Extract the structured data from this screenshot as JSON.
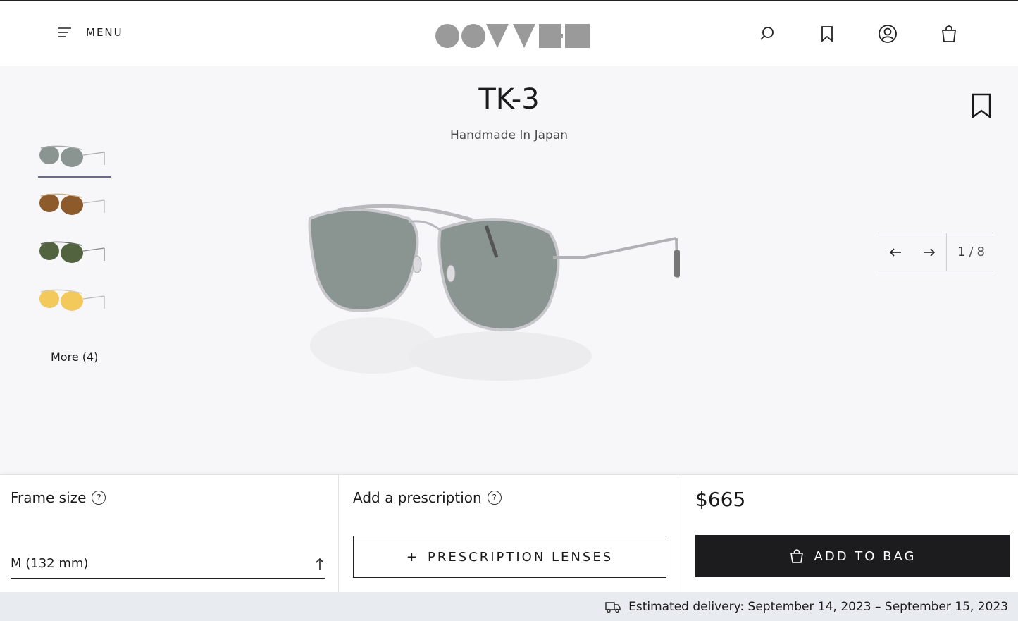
{
  "header": {
    "menu_label": "MENU",
    "logo_alt": "OLIVER PEOPLES",
    "icons": [
      "hamburger-icon",
      "search-icon",
      "bookmark-icon",
      "account-icon",
      "shopping-bag-icon"
    ]
  },
  "product": {
    "name": "TK-3",
    "subtitle": "Handmade In Japan",
    "thumbnails": [
      {
        "lens": "grey",
        "lens_color": "#8a9592",
        "active": true
      },
      {
        "lens": "brown",
        "lens_color": "#8c5a2b",
        "active": false
      },
      {
        "lens": "green",
        "lens_color": "#52643f",
        "active": false
      },
      {
        "lens": "yellow",
        "lens_color": "#f2c95a",
        "active": false
      }
    ],
    "more_label": "More (4)",
    "carousel": {
      "current": "1",
      "separator": "/",
      "total": "8"
    }
  },
  "purchase": {
    "frame_size_label": "Frame size",
    "frame_size_value": "M (132 mm)",
    "prescription_label": "Add a prescription",
    "prescription_button": "PRESCRIPTION LENSES",
    "prescription_plus": "+",
    "price": "$665",
    "add_to_bag": "ADD TO BAG",
    "help_glyph": "?"
  },
  "delivery": {
    "text": "Estimated delivery: September 14, 2023 – September 15, 2023"
  },
  "colors": {
    "accent_dark": "#1c1c1e",
    "background": "#f7f7f9",
    "delivery_bar": "#e8ecf0"
  }
}
